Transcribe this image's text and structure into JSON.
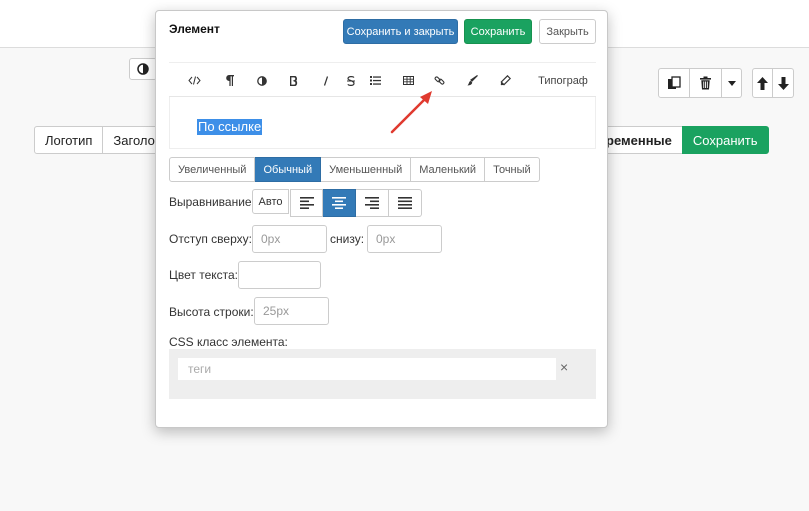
{
  "background": {
    "left_buttons": [
      "Логотип",
      "Заголово"
    ],
    "right_buttons": {
      "vars": "ременные",
      "save": "Сохранить"
    }
  },
  "modal": {
    "title": "Элемент",
    "buttons": {
      "save_close": "Сохранить и закрыть",
      "save": "Сохранить",
      "close": "Закрыть"
    },
    "toolbar": {
      "typograf": "Типограф"
    },
    "editor_text": "По ссылке",
    "sizes": [
      "Увеличенный",
      "Обычный",
      "Уменьшенный",
      "Маленький",
      "Точный"
    ],
    "active_size": "Обычный",
    "align": {
      "label": "Выравнивание",
      "auto": "Авто",
      "active": "center"
    },
    "indent": {
      "top_label": "Отступ сверху:",
      "top_placeholder": "0px",
      "bottom_label": "снизу:",
      "bottom_placeholder": "0px"
    },
    "text_color": {
      "label": "Цвет текста:",
      "value": ""
    },
    "line_height": {
      "label": "Высота строки:",
      "placeholder": "25px"
    },
    "css_class": {
      "label": "CSS класс элемента:",
      "placeholder": "теги",
      "clear": "×"
    }
  },
  "colors": {
    "primary": "#337ab7",
    "success": "#1aa260",
    "highlight": "#3d8fe8",
    "arrow": "#e03a2f"
  }
}
